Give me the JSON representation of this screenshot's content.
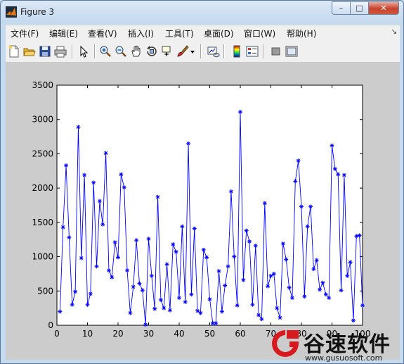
{
  "window": {
    "title": "Figure 3",
    "controls": {
      "minimize": "–",
      "maximize": "□",
      "close": "✕"
    }
  },
  "menu": [
    "文件(F)",
    "编辑(E)",
    "查看(V)",
    "插入(I)",
    "工具(T)",
    "桌面(D)",
    "窗口(W)",
    "帮助(H)"
  ],
  "menu_dock_symbol": "↘",
  "toolbar": [
    "new-figure-icon",
    "open-file-icon",
    "save-icon",
    "print-icon",
    "edit-plot-arrow-icon",
    "zoom-in-icon",
    "zoom-out-icon",
    "pan-hand-icon",
    "rotate-3d-icon",
    "data-cursor-icon",
    "brush-icon",
    "brush-dropdown-icon",
    "link-plot-icon",
    "colorbar-icon",
    "legend-icon",
    "hide-plot-tools-icon",
    "show-plot-tools-icon"
  ],
  "chart_data": {
    "type": "line",
    "marker": "*",
    "color": "#0000ff",
    "xlim": [
      0,
      100
    ],
    "ylim": [
      0,
      3500
    ],
    "xticks": [
      0,
      10,
      20,
      30,
      40,
      50,
      60,
      70,
      80,
      90,
      100
    ],
    "yticks": [
      0,
      500,
      1000,
      1500,
      2000,
      2500,
      3000,
      3500
    ],
    "grid": false,
    "x": [
      1,
      2,
      3,
      4,
      5,
      6,
      7,
      8,
      9,
      10,
      11,
      12,
      13,
      14,
      15,
      16,
      17,
      18,
      19,
      20,
      21,
      22,
      23,
      24,
      25,
      26,
      27,
      28,
      29,
      30,
      31,
      32,
      33,
      34,
      35,
      36,
      37,
      38,
      39,
      40,
      41,
      42,
      43,
      44,
      45,
      46,
      47,
      48,
      49,
      50,
      51,
      52,
      53,
      54,
      55,
      56,
      57,
      58,
      59,
      60,
      61,
      62,
      63,
      64,
      65,
      66,
      67,
      68,
      69,
      70,
      71,
      72,
      73,
      74,
      75,
      76,
      77,
      78,
      79,
      80,
      81,
      82,
      83,
      84,
      85,
      86,
      87,
      88,
      89,
      90,
      91,
      92,
      93,
      94,
      95,
      96,
      97,
      98,
      99,
      100
    ],
    "y": [
      200,
      1430,
      2330,
      1280,
      300,
      490,
      2890,
      980,
      2190,
      300,
      460,
      2080,
      860,
      1810,
      1470,
      2510,
      800,
      700,
      1210,
      990,
      2200,
      2010,
      800,
      180,
      560,
      1240,
      610,
      510,
      10,
      1260,
      720,
      240,
      1870,
      370,
      250,
      890,
      220,
      1180,
      1070,
      400,
      1440,
      340,
      2650,
      450,
      1410,
      210,
      180,
      1100,
      990,
      380,
      30,
      30,
      790,
      200,
      580,
      860,
      1950,
      1000,
      290,
      3110,
      660,
      1380,
      1220,
      300,
      1160,
      150,
      90,
      1780,
      570,
      720,
      750,
      250,
      110,
      1190,
      960,
      550,
      400,
      2100,
      2400,
      1730,
      420,
      1440,
      1730,
      820,
      950,
      520,
      620,
      450,
      400,
      2620,
      2280,
      2200,
      510,
      2190,
      720,
      920,
      70,
      1300,
      1310,
      290
    ]
  },
  "watermark": {
    "title": "谷速软件",
    "url": "www.gusuosoft.com"
  }
}
